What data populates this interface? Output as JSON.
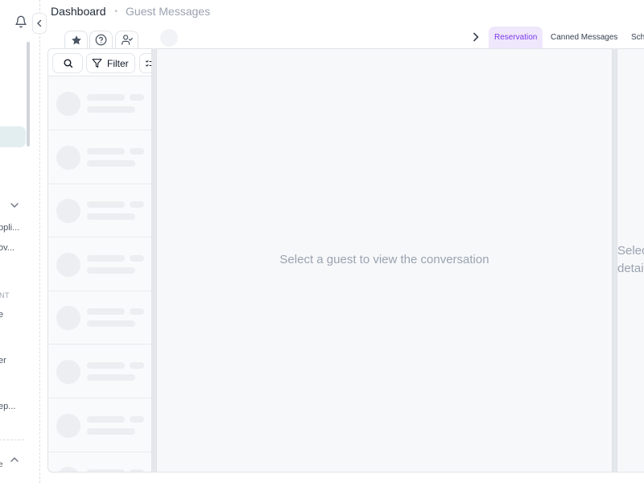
{
  "header": {
    "title": "Dashboard",
    "separator": "•",
    "subtitle": "Guest Messages"
  },
  "sidebar": {
    "items": [
      {
        "label": "ppli..."
      },
      {
        "label": "ov..."
      },
      {
        "label": "e"
      },
      {
        "label": "er"
      },
      {
        "label": "ep..."
      }
    ],
    "section_label": "NT",
    "bottom_label": "e"
  },
  "icon_tabs": [
    {
      "icon": "star-icon"
    },
    {
      "icon": "help-circle-icon"
    },
    {
      "icon": "user-check-icon"
    }
  ],
  "right_tabs": [
    {
      "label": "Reservation",
      "active": true
    },
    {
      "label": "Canned Messages",
      "active": false
    },
    {
      "label": "Sch",
      "active": false
    }
  ],
  "guest_list": {
    "filter_label": "Filter",
    "skeleton_rows": 8
  },
  "conversation": {
    "empty_message": "Select a guest to view the conversation"
  },
  "details": {
    "line1": "Selec",
    "line2": "detai"
  },
  "colors": {
    "accent_tab_bg": "#efe7fb",
    "accent_tab_text": "#7c3aed",
    "sidebar_active_bg": "#e3eef0",
    "muted_text": "#9aa3b0"
  }
}
